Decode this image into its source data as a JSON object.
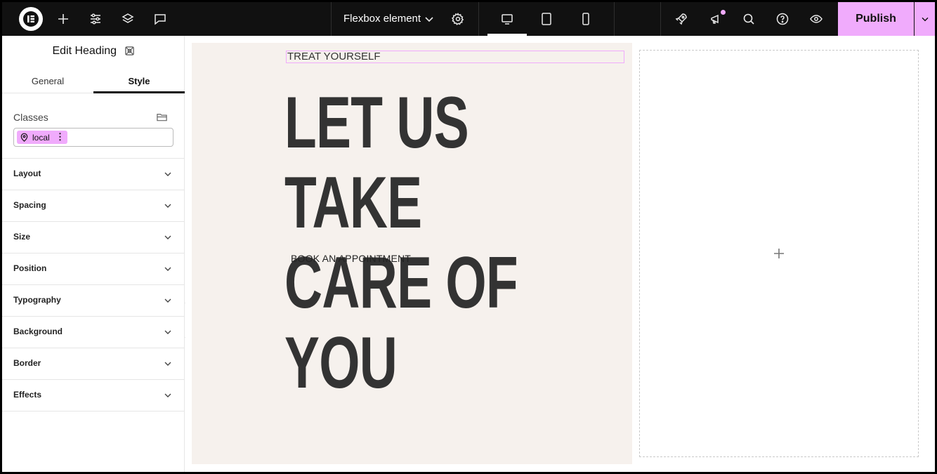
{
  "topbar": {
    "document_title": "Flexbox element",
    "publish_label": "Publish",
    "icons": [
      "elementor-logo-icon",
      "plus-icon",
      "sliders-icon",
      "layers-icon",
      "comment-icon",
      "chevron-down-icon",
      "gear-icon",
      "desktop-icon",
      "tablet-icon",
      "mobile-icon",
      "rocket-icon",
      "megaphone-icon",
      "search-icon",
      "help-icon",
      "eye-icon"
    ],
    "accent_color": "#f0abfc"
  },
  "panel": {
    "title": "Edit Heading",
    "tabs": [
      {
        "label": "General",
        "active": false
      },
      {
        "label": "Style",
        "active": true
      }
    ],
    "classes_label": "Classes",
    "class_chip": "local",
    "sections": [
      {
        "label": "Layout"
      },
      {
        "label": "Spacing"
      },
      {
        "label": "Size"
      },
      {
        "label": "Position"
      },
      {
        "label": "Typography"
      },
      {
        "label": "Background"
      },
      {
        "label": "Border"
      },
      {
        "label": "Effects"
      }
    ]
  },
  "canvas": {
    "eyebrow": "TREAT YOURSELF",
    "headline_line1": "LET US TAKE",
    "headline_line2": "CARE OF YOU",
    "cta": "BOOK AN APPOINTMENT",
    "hero_background": "#f6f1ed"
  }
}
